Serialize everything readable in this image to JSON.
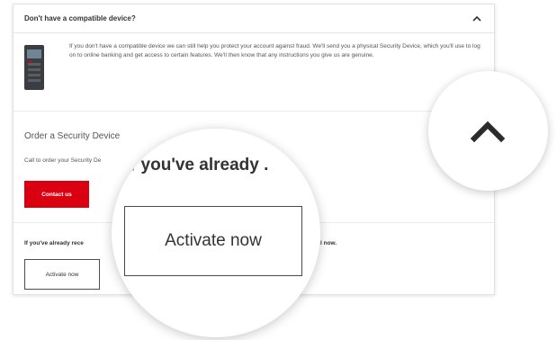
{
  "panel": {
    "title": "Don't have a compatible device?",
    "description": "If you don't have a compatible device we can still help you protect your account against fraud. We'll send you a physical Security Device, which you'll use to log on to online banking and get access to certain features. We'll then know that any instructions you give us are genuine."
  },
  "order": {
    "heading": "Order a Security Device",
    "call_text": "Call to order your Security De",
    "contact_button": "Contact us"
  },
  "activate": {
    "prompt_left": "If you've already rece",
    "prompt_right": "l now.",
    "button_label": "Activate now"
  },
  "magnifier": {
    "prompt_text": "/ you've already .",
    "button_label": "Activate now"
  },
  "colors": {
    "accent_red": "#db0011",
    "text_dark": "#333333",
    "border_gray": "#4d4d4d"
  },
  "icons": {
    "collapse": "chevron-up-icon",
    "device": "security-device-icon"
  }
}
